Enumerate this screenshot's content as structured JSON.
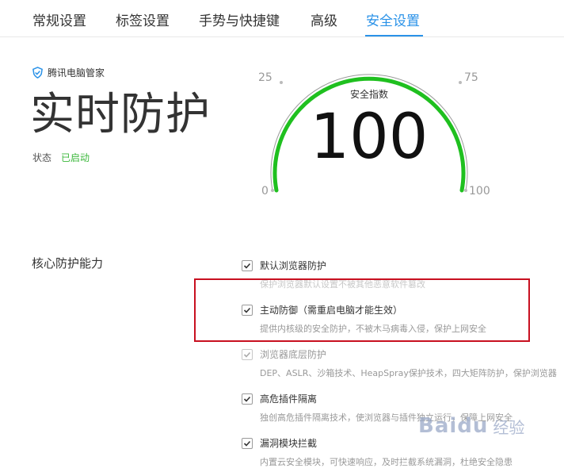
{
  "tabs": [
    {
      "label": "常规设置",
      "active": false
    },
    {
      "label": "标签设置",
      "active": false
    },
    {
      "label": "手势与快捷键",
      "active": false
    },
    {
      "label": "高级",
      "active": false
    },
    {
      "label": "安全设置",
      "active": true
    }
  ],
  "accent_color": "#2a92e8",
  "brand": {
    "name": "腾讯电脑管家",
    "icon": "shield-icon"
  },
  "realtime": {
    "title": "实时防护",
    "status_label": "状态",
    "status_value": "已启动",
    "status_color": "#3cb83c"
  },
  "gauge": {
    "caption": "安全指数",
    "value": "100",
    "fraction": 1.0,
    "color": "#1fc01f",
    "ticks": [
      "0",
      "25",
      "75",
      "100"
    ]
  },
  "section": {
    "label": "核心防护能力"
  },
  "options": [
    {
      "title": "默认浏览器防护",
      "description": "保护浏览器默认设置不被其他恶意软件篡改",
      "checked": true,
      "disabled": false
    },
    {
      "title": "主动防御（需重启电脑才能生效）",
      "description": "提供内核级的安全防护，不被木马病毒入侵，保护上网安全",
      "checked": true,
      "disabled": false
    },
    {
      "title": "浏览器底层防护",
      "description": "DEP、ASLR、沙箱技术、HeapSpray保护技术，四大矩阵防护，保护浏览器",
      "checked": true,
      "disabled": true
    },
    {
      "title": "高危插件隔离",
      "description": "独创高危插件隔离技术，使浏览器与插件独立运行，保障上网安全",
      "checked": true,
      "disabled": false
    },
    {
      "title": "漏洞模块拦截",
      "description": "内置云安全模块，可快速响应，及时拦截系统漏洞，杜绝安全隐患",
      "checked": true,
      "disabled": false
    }
  ],
  "watermark": {
    "text": "Baidu",
    "cn": "经验"
  }
}
